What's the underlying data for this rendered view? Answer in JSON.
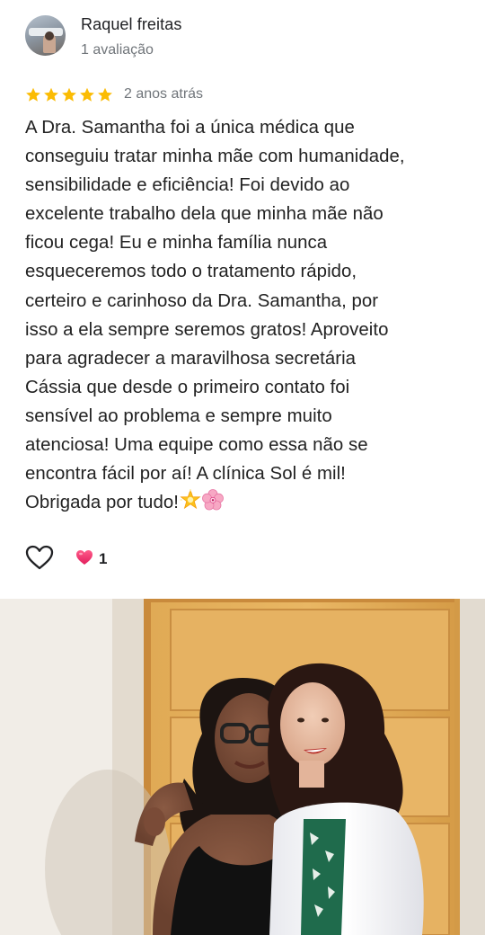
{
  "review": {
    "author": "Raquel freitas",
    "author_meta": "1 avaliação",
    "rating": 5,
    "rating_max": 5,
    "date": "2 anos atrás",
    "text_lines": [
      "A Dra. Samantha foi a única médica que",
      "conseguiu tratar minha mãe com humanidade,",
      "sensibilidade e eficiência! Foi devido ao",
      "excelente trabalho dela que minha mãe não",
      "ficou cega! Eu e minha família nunca",
      "esqueceremos todo o tratamento rápido,",
      "certeiro e carinhoso da Dra. Samantha, por",
      "isso a ela sempre seremos gratos! Aproveito",
      "para agradecer a maravilhosa secretária",
      "Cássia que desde o primeiro contato foi",
      "sensível ao problema e sempre muito",
      "atenciosa! Uma equipe como essa não se",
      "encontra fácil por aí! A clínica Sol é mil!",
      "Obrigada por tudo!"
    ],
    "reaction_count": "1"
  },
  "icons": {
    "star_color": "#fbbc04",
    "like": "heart-outline-icon",
    "reaction": "red-heart-icon",
    "emoji_1": "glowing-star-emoji",
    "emoji_2": "cherry-blossom-emoji"
  },
  "colors": {
    "secondary_text": "#70757a",
    "reaction_heart": "#e8336d"
  }
}
